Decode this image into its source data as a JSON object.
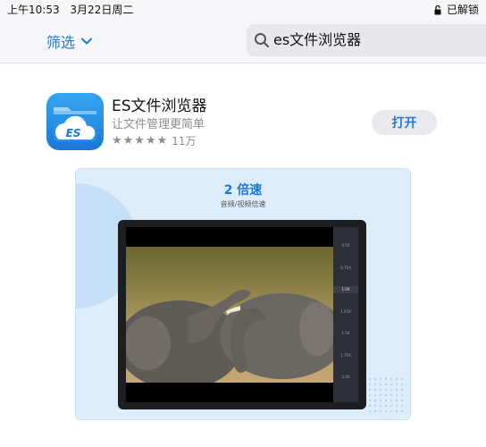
{
  "status_bar": {
    "time": "上午10:53",
    "date": "3月22日周二",
    "lock_status": "已解锁",
    "lock_icon": "unlocked-lock-icon"
  },
  "toolbar": {
    "filter_label": "筛选",
    "filter_icon": "chevron-down-icon",
    "search_icon": "search-icon",
    "search_value": "es文件浏览器",
    "accent_color": "#1f7ae0"
  },
  "app": {
    "icon_text": "ES",
    "name": "ES文件浏览器",
    "subtitle": "让文件管理更简单",
    "stars": "★★★★★",
    "rating_count": "11万",
    "open_label": "打开"
  },
  "screenshot": {
    "title": "2 倍速",
    "subtitle": "音频/视频倍速",
    "speed_options": [
      "0.5X",
      "0.75X",
      "1.0X",
      "1.25X",
      "1.5X",
      "1.75X",
      "2.0X"
    ],
    "active_speed": "1.0X"
  }
}
